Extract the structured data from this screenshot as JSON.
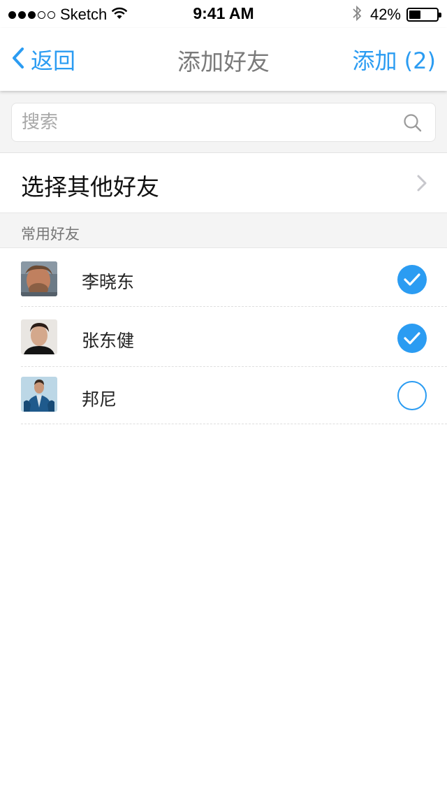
{
  "status_bar": {
    "carrier": "Sketch",
    "time": "9:41 AM",
    "battery_percent_label": "42%",
    "battery_level": 0.42,
    "signal_bars_filled": 3,
    "signal_bars_total": 5
  },
  "nav": {
    "back_label": "返回",
    "title": "添加好友",
    "action_label": "添加 (2)"
  },
  "search": {
    "placeholder": "搜索",
    "value": ""
  },
  "select_other": {
    "label": "选择其他好友"
  },
  "section": {
    "title": "常用好友"
  },
  "friends": [
    {
      "name": "李晓东",
      "selected": true
    },
    {
      "name": "张东健",
      "selected": true
    },
    {
      "name": "邦尼",
      "selected": false
    }
  ],
  "colors": {
    "accent": "#2b9cf2",
    "title_gray": "#7a7a7a",
    "section_bg": "#f4f4f4"
  }
}
